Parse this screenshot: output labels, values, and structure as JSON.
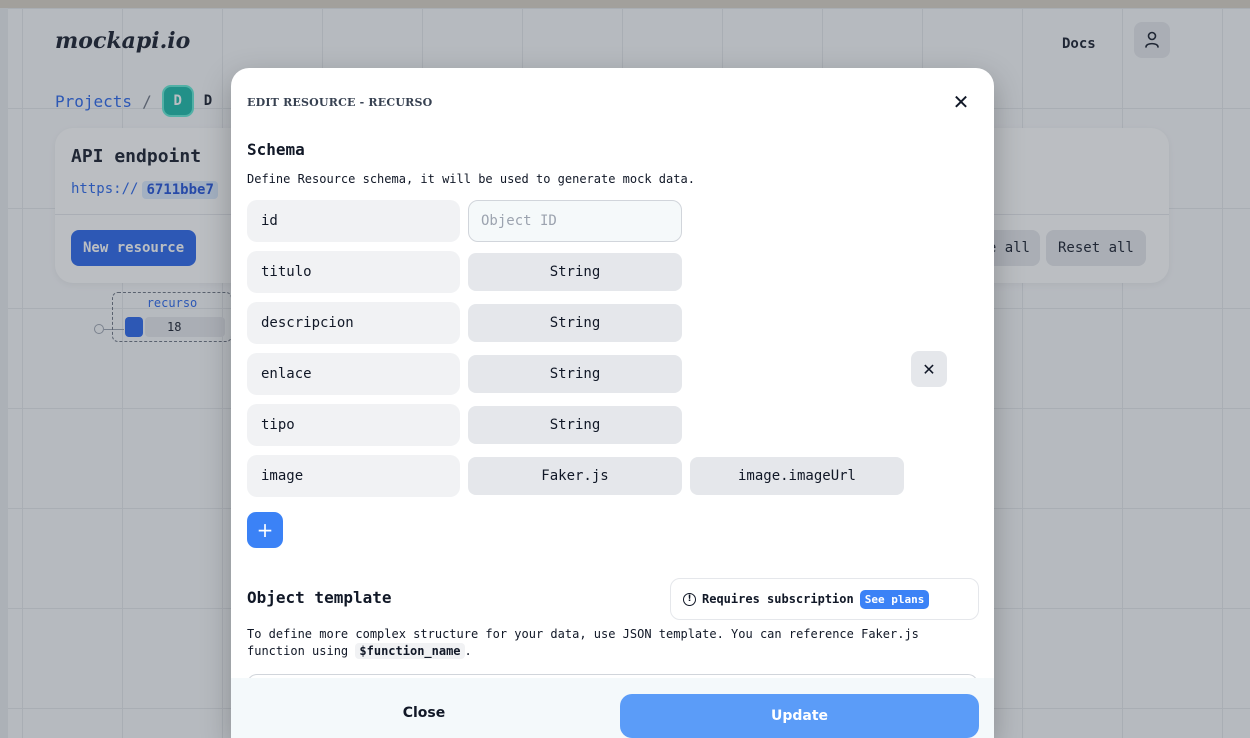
{
  "header": {
    "logo": "mockapi.io",
    "docs_label": "Docs",
    "user_icon": "user-icon"
  },
  "breadcrumb": {
    "projects_label": "Projects",
    "separator": "/",
    "project_initial": "D",
    "project_name_visible": "D"
  },
  "api_card": {
    "title": "API endpoint",
    "url_prefix": "https://",
    "url_hash": "6711bbe7",
    "new_resource_label": "New resource",
    "generate_all_visible": "e all",
    "reset_all_label": "Reset all"
  },
  "resource_node": {
    "name": "recurso",
    "count": "18"
  },
  "modal": {
    "title": "EDIT RESOURCE - RECURSO",
    "close_icon": "close-icon",
    "schema_title": "Schema",
    "schema_description": "Define Resource schema, it will be used to generate mock data.",
    "fields": [
      {
        "name": "id",
        "placeholder": "Object ID"
      },
      {
        "name": "titulo",
        "type": "String"
      },
      {
        "name": "descripcion",
        "type": "String"
      },
      {
        "name": "enlace",
        "type": "String"
      },
      {
        "name": "tipo",
        "type": "String"
      },
      {
        "name": "image",
        "type": "Faker.js",
        "method": "image.imageUrl"
      }
    ],
    "remove_icon": "close-icon",
    "add_icon": "plus-icon",
    "template_title": "Object template",
    "subscription_text": "Requires subscription",
    "see_plans_label": "See plans",
    "template_desc_part1": "To define more complex structure for your data, use JSON template. You can reference Faker.js function using",
    "template_desc_code": "$function_name",
    "template_desc_part2": ".",
    "close_label": "Close",
    "update_label": "Update"
  }
}
